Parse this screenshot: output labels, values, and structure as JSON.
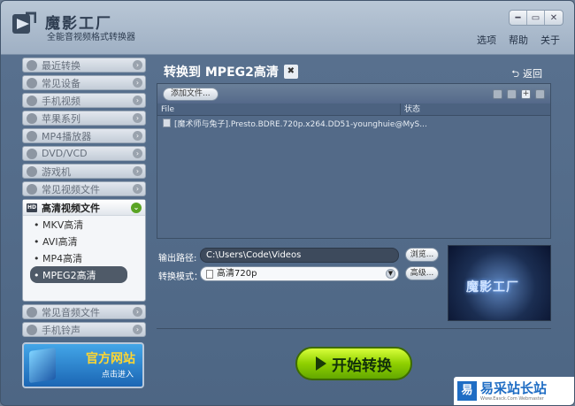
{
  "header": {
    "title": "魔影工厂",
    "subtitle": "全能音视频格式转换器",
    "window_controls": [
      "━",
      "▭",
      "✕"
    ],
    "links": [
      "选项",
      "帮助",
      "关于"
    ]
  },
  "sidebar": {
    "items_top": [
      {
        "label": "最近转换",
        "icon": "clock-icon"
      },
      {
        "label": "常见设备",
        "icon": "device-icon"
      },
      {
        "label": "手机视频",
        "icon": "phone-icon"
      },
      {
        "label": "苹果系列",
        "icon": "apple-icon"
      },
      {
        "label": "MP4播放器",
        "icon": "mp4-icon"
      },
      {
        "label": "DVD/VCD",
        "icon": "disc-icon"
      },
      {
        "label": "游戏机",
        "icon": "gamepad-icon"
      },
      {
        "label": "常见视频文件",
        "icon": "film-icon"
      }
    ],
    "group": {
      "label": "高清视频文件",
      "badge": "HD",
      "subitems": [
        "• MKV高清",
        "• AVI高清",
        "• MP4高清",
        "• MPEG2高清"
      ],
      "active_index": 3
    },
    "items_bottom": [
      {
        "label": "常见音频文件",
        "icon": "music-icon"
      },
      {
        "label": "手机铃声",
        "icon": "bell-icon"
      }
    ],
    "promo": {
      "title": "官方网站",
      "subtitle": "点击进入"
    }
  },
  "main": {
    "title": "转换到 MPEG2高清",
    "back_label": "返回",
    "add_file_label": "添加文件...",
    "columns": {
      "file": "File",
      "status": "状态"
    },
    "files": [
      {
        "name": "[魔术师与兔子].Presto.BDRE.720p.x264.DD51-younghuie@MyS...",
        "status": ""
      }
    ],
    "output_label": "输出路径:",
    "output_path": "C:\\Users\\Code\\Videos",
    "browse_label": "浏览...",
    "mode_label": "转换模式：",
    "mode_value": "高清720p",
    "advanced_label": "高级...",
    "preview_logo": "魔影工厂",
    "start_label": "开始转换"
  },
  "watermark": {
    "logo": "易",
    "text": "易采站长站",
    "url": "Www.Easck.Com Webmaster"
  },
  "colors": {
    "accent_green": "#8fd000",
    "panel_blue": "#5a7291",
    "header_dark": "#2f3e52"
  }
}
